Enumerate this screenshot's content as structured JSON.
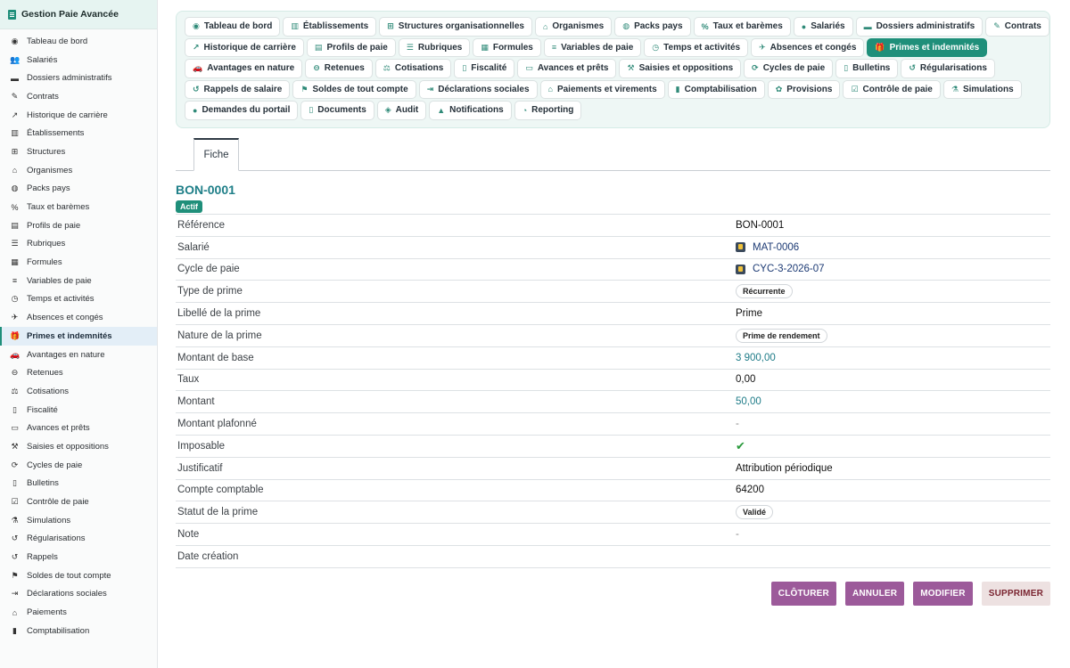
{
  "sidebar": {
    "title": "Gestion Paie Avancée",
    "items": [
      {
        "label": "Tableau de bord",
        "icon": "dashboard-icon",
        "glyph": "◉"
      },
      {
        "label": "Salariés",
        "icon": "users-icon",
        "glyph": "👥"
      },
      {
        "label": "Dossiers administratifs",
        "icon": "folder-icon",
        "glyph": "▬"
      },
      {
        "label": "Contrats",
        "icon": "contract-icon",
        "glyph": "✎"
      },
      {
        "label": "Historique de carrière",
        "icon": "chart-line-icon",
        "glyph": "↗"
      },
      {
        "label": "Établissements",
        "icon": "building-icon",
        "glyph": "▥"
      },
      {
        "label": "Structures",
        "icon": "sitemap-icon",
        "glyph": "⊞"
      },
      {
        "label": "Organismes",
        "icon": "bank-icon",
        "glyph": "⌂"
      },
      {
        "label": "Packs pays",
        "icon": "globe-icon",
        "glyph": "◍"
      },
      {
        "label": "Taux et barèmes",
        "icon": "percent-icon",
        "glyph": "%"
      },
      {
        "label": "Profils de paie",
        "icon": "id-card-icon",
        "glyph": "▤"
      },
      {
        "label": "Rubriques",
        "icon": "list-icon",
        "glyph": "☰"
      },
      {
        "label": "Formules",
        "icon": "calculator-icon",
        "glyph": "▦"
      },
      {
        "label": "Variables de paie",
        "icon": "sliders-icon",
        "glyph": "≡"
      },
      {
        "label": "Temps et activités",
        "icon": "clock-icon",
        "glyph": "◷"
      },
      {
        "label": "Absences et congés",
        "icon": "plane-icon",
        "glyph": "✈"
      },
      {
        "label": "Primes et indemnités",
        "icon": "gift-icon",
        "glyph": "🎁"
      },
      {
        "label": "Avantages en nature",
        "icon": "car-icon",
        "glyph": "🚗"
      },
      {
        "label": "Retenues",
        "icon": "minus-circle-icon",
        "glyph": "⊖"
      },
      {
        "label": "Cotisations",
        "icon": "hand-coins-icon",
        "glyph": "⚖"
      },
      {
        "label": "Fiscalité",
        "icon": "file-invoice-icon",
        "glyph": "▯"
      },
      {
        "label": "Avances et prêts",
        "icon": "money-bill-icon",
        "glyph": "▭"
      },
      {
        "label": "Saisies et oppositions",
        "icon": "gavel-icon",
        "glyph": "⚒"
      },
      {
        "label": "Cycles de paie",
        "icon": "sync-icon",
        "glyph": "⟳"
      },
      {
        "label": "Bulletins",
        "icon": "document-icon",
        "glyph": "▯"
      },
      {
        "label": "Contrôle de paie",
        "icon": "clipboard-check-icon",
        "glyph": "☑"
      },
      {
        "label": "Simulations",
        "icon": "flask-icon",
        "glyph": "⚗"
      },
      {
        "label": "Régularisations",
        "icon": "undo-icon",
        "glyph": "↺"
      },
      {
        "label": "Rappels",
        "icon": "history-icon",
        "glyph": "↺"
      },
      {
        "label": "Soldes de tout compte",
        "icon": "flag-icon",
        "glyph": "⚑"
      },
      {
        "label": "Déclarations sociales",
        "icon": "file-export-icon",
        "glyph": "⇥"
      },
      {
        "label": "Paiements",
        "icon": "bank-icon",
        "glyph": "⌂"
      },
      {
        "label": "Comptabilisation",
        "icon": "book-icon",
        "glyph": "▮"
      }
    ],
    "active_index": 16
  },
  "nav": {
    "rows": [
      [
        {
          "label": "Tableau de bord",
          "icon": "dashboard-icon",
          "glyph": "◉"
        },
        {
          "label": "Établissements",
          "icon": "building-icon",
          "glyph": "▥"
        },
        {
          "label": "Structures organisationnelles",
          "icon": "sitemap-icon",
          "glyph": "⊞"
        },
        {
          "label": "Organismes",
          "icon": "bank-icon",
          "glyph": "⌂"
        },
        {
          "label": "Packs pays",
          "icon": "globe-icon",
          "glyph": "◍"
        },
        {
          "label": "Taux et barèmes",
          "icon": "percent-icon",
          "glyph": "%"
        },
        {
          "label": "Salariés",
          "icon": "user-icon",
          "glyph": "●"
        },
        {
          "label": "Dossiers administratifs",
          "icon": "folder-icon",
          "glyph": "▬"
        },
        {
          "label": "Contrats",
          "icon": "contract-icon",
          "glyph": "✎"
        }
      ],
      [
        {
          "label": "Historique de carrière",
          "icon": "chart-line-icon",
          "glyph": "↗"
        },
        {
          "label": "Profils de paie",
          "icon": "id-card-icon",
          "glyph": "▤"
        },
        {
          "label": "Rubriques",
          "icon": "list-icon",
          "glyph": "☰"
        },
        {
          "label": "Formules",
          "icon": "calculator-icon",
          "glyph": "▦"
        },
        {
          "label": "Variables de paie",
          "icon": "sliders-icon",
          "glyph": "≡"
        },
        {
          "label": "Temps et activités",
          "icon": "clock-icon",
          "glyph": "◷"
        },
        {
          "label": "Absences et congés",
          "icon": "plane-icon",
          "glyph": "✈"
        },
        {
          "label": "Primes et indemnités",
          "icon": "gift-icon",
          "glyph": "🎁",
          "active": true
        }
      ],
      [
        {
          "label": "Avantages en nature",
          "icon": "car-icon",
          "glyph": "🚗"
        },
        {
          "label": "Retenues",
          "icon": "minus-circle-icon",
          "glyph": "⊖"
        },
        {
          "label": "Cotisations",
          "icon": "hand-coins-icon",
          "glyph": "⚖"
        },
        {
          "label": "Fiscalité",
          "icon": "file-invoice-icon",
          "glyph": "▯"
        },
        {
          "label": "Avances et prêts",
          "icon": "money-bill-icon",
          "glyph": "▭"
        },
        {
          "label": "Saisies et oppositions",
          "icon": "gavel-icon",
          "glyph": "⚒"
        },
        {
          "label": "Cycles de paie",
          "icon": "sync-icon",
          "glyph": "⟳"
        },
        {
          "label": "Bulletins",
          "icon": "document-icon",
          "glyph": "▯"
        },
        {
          "label": "Régularisations",
          "icon": "undo-icon",
          "glyph": "↺"
        }
      ],
      [
        {
          "label": "Rappels de salaire",
          "icon": "history-icon",
          "glyph": "↺"
        },
        {
          "label": "Soldes de tout compte",
          "icon": "flag-icon",
          "glyph": "⚑"
        },
        {
          "label": "Déclarations sociales",
          "icon": "file-export-icon",
          "glyph": "⇥"
        },
        {
          "label": "Paiements et virements",
          "icon": "bank-icon",
          "glyph": "⌂"
        },
        {
          "label": "Comptabilisation",
          "icon": "book-icon",
          "glyph": "▮"
        },
        {
          "label": "Provisions",
          "icon": "piggy-bank-icon",
          "glyph": "✿"
        },
        {
          "label": "Contrôle de paie",
          "icon": "clipboard-check-icon",
          "glyph": "☑"
        },
        {
          "label": "Simulations",
          "icon": "flask-icon",
          "glyph": "⚗"
        }
      ],
      [
        {
          "label": "Demandes du portail",
          "icon": "comment-icon",
          "glyph": "●"
        },
        {
          "label": "Documents",
          "icon": "file-icon",
          "glyph": "▯"
        },
        {
          "label": "Audit",
          "icon": "shield-icon",
          "glyph": "◈"
        },
        {
          "label": "Notifications",
          "icon": "bell-icon",
          "glyph": "▲"
        },
        {
          "label": "Reporting",
          "icon": "pie-chart-icon",
          "glyph": "◔"
        }
      ]
    ]
  },
  "tabs": {
    "fiche": "Fiche"
  },
  "record": {
    "title": "BON-0001",
    "status": "Actif"
  },
  "fields": [
    {
      "key": "reference",
      "label": "Référence",
      "value": "BON-0001",
      "type": "text"
    },
    {
      "key": "salarie",
      "label": "Salarié",
      "value": "MAT-0006",
      "type": "link"
    },
    {
      "key": "cycle",
      "label": "Cycle de paie",
      "value": "CYC-3-2026-07",
      "type": "link"
    },
    {
      "key": "type",
      "label": "Type de prime",
      "value": "Récurrente",
      "type": "chip"
    },
    {
      "key": "libelle",
      "label": "Libellé de la prime",
      "value": "Prime",
      "type": "text"
    },
    {
      "key": "nature",
      "label": "Nature de la prime",
      "value": "Prime de rendement",
      "type": "chip"
    },
    {
      "key": "base",
      "label": "Montant de base",
      "value": "3 900,00",
      "type": "money"
    },
    {
      "key": "taux",
      "label": "Taux",
      "value": "0,00",
      "type": "text"
    },
    {
      "key": "montant",
      "label": "Montant",
      "value": "50,00",
      "type": "money"
    },
    {
      "key": "plafonne",
      "label": "Montant plafonné",
      "value": "-",
      "type": "dash"
    },
    {
      "key": "imposable",
      "label": "Imposable",
      "value": "",
      "type": "check"
    },
    {
      "key": "justificatif",
      "label": "Justificatif",
      "value": "Attribution périodique",
      "type": "text"
    },
    {
      "key": "compte",
      "label": "Compte comptable",
      "value": "64200",
      "type": "text"
    },
    {
      "key": "statut",
      "label": "Statut de la prime",
      "value": "Validé",
      "type": "chip"
    },
    {
      "key": "note",
      "label": "Note",
      "value": "-",
      "type": "dash"
    },
    {
      "key": "date",
      "label": "Date création",
      "value": "",
      "type": "text"
    }
  ],
  "actions": {
    "cloturer": "CLÔTURER",
    "annuler": "ANNULER",
    "modifier": "MODIFIER",
    "supprimer": "SUPPRIMER"
  },
  "colors": {
    "accent": "#1f8f7a",
    "button": "#9c5a9a",
    "danger_text": "#7a2430",
    "link": "#1c3a74",
    "money": "#1f7c88"
  }
}
